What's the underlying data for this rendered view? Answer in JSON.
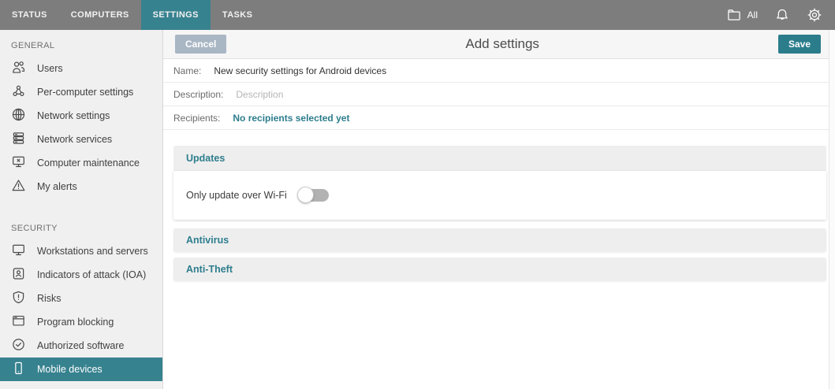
{
  "colors": {
    "accent_teal": "#37828f",
    "save_button": "#2c7d8c",
    "cancel_button": "#a9b6c4",
    "nav_background": "#7d7d7d",
    "sidebar_background": "#f0f0f0"
  },
  "nav": {
    "tabs": [
      {
        "label": "STATUS",
        "active": false
      },
      {
        "label": "COMPUTERS",
        "active": false
      },
      {
        "label": "SETTINGS",
        "active": true
      },
      {
        "label": "TASKS",
        "active": false
      }
    ],
    "filter": {
      "icon": "folder-icon",
      "label": "All"
    },
    "icons": [
      "bell-icon",
      "gear-icon"
    ]
  },
  "sidebar": {
    "sections": [
      {
        "title": "GENERAL",
        "items": [
          {
            "label": "Users",
            "icon": "users-icon"
          },
          {
            "label": "Per-computer settings",
            "icon": "nodes-icon"
          },
          {
            "label": "Network settings",
            "icon": "globe-icon"
          },
          {
            "label": "Network services",
            "icon": "server-stack-icon"
          },
          {
            "label": "Computer maintenance",
            "icon": "monitor-x-icon"
          },
          {
            "label": "My alerts",
            "icon": "warning-triangle-icon"
          }
        ]
      },
      {
        "title": "SECURITY",
        "items": [
          {
            "label": "Workstations and servers",
            "icon": "monitor-icon"
          },
          {
            "label": "Indicators of attack (IOA)",
            "icon": "id-badge-icon"
          },
          {
            "label": "Risks",
            "icon": "shield-exclamation-icon"
          },
          {
            "label": "Program blocking",
            "icon": "window-icon"
          },
          {
            "label": "Authorized software",
            "icon": "check-circle-icon"
          },
          {
            "label": "Mobile devices",
            "icon": "smartphone-icon",
            "selected": true
          }
        ]
      }
    ]
  },
  "header": {
    "cancel_label": "Cancel",
    "title": "Add settings",
    "save_label": "Save"
  },
  "form": {
    "name_label": "Name:",
    "name_value": "New security settings for Android devices",
    "description_label": "Description:",
    "description_placeholder": "Description",
    "recipients_label": "Recipients:",
    "recipients_value": "No recipients selected yet"
  },
  "panels": {
    "updates": {
      "title": "Updates",
      "toggle_label": "Only update over Wi-Fi",
      "toggle_state": "off",
      "expanded": true
    },
    "antivirus": {
      "title": "Antivirus",
      "expanded": false
    },
    "anti_theft": {
      "title": "Anti-Theft",
      "expanded": false
    }
  }
}
